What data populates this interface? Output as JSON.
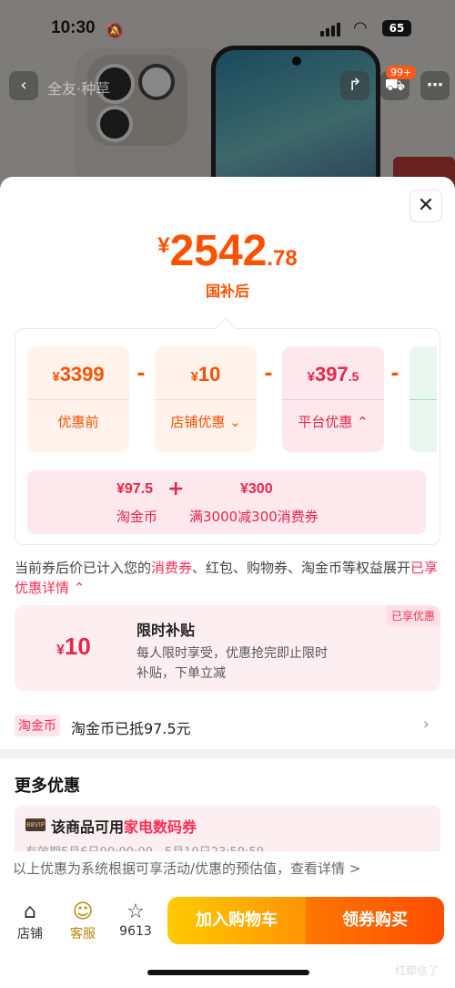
{
  "status_bar": {
    "time": "10:30",
    "battery": "65"
  },
  "nav": {
    "title": "全友·种草",
    "cart_badge": "99+"
  },
  "sheet": {
    "price": {
      "currency": "¥",
      "integer": "2542",
      "decimal": ".78",
      "label": "国补后"
    },
    "breakdown": [
      {
        "currency": "¥",
        "value": "3399",
        "decimal": "",
        "label": "优惠前"
      },
      {
        "currency": "¥",
        "value": "10",
        "decimal": "",
        "label": "店铺优惠",
        "chevron": "⌄"
      },
      {
        "currency": "¥",
        "value": "397",
        "decimal": ".5",
        "label": "平台优惠",
        "chevron": "⌃"
      }
    ],
    "operators": [
      "-",
      "-",
      "-"
    ],
    "platform_detail": {
      "coin_value": "¥97.5",
      "coin_label": "淘金币",
      "plus": "+",
      "coupon_value": "¥300",
      "coupon_label": "满3000减300消费券"
    },
    "notice": {
      "prefix": "当前券后价已计入您的",
      "highlight1": "消费券",
      "middle": "、红包、购物券、淘金币等权益展开",
      "link": "已享优惠详情",
      "link_chevron": "⌃"
    },
    "subsidy": {
      "currency": "¥",
      "amount": "10",
      "title": "限时补贴",
      "desc": "每人限时享受，优惠抢完即止限时补贴，下单立减",
      "tag": "已享优惠"
    },
    "coin_row": {
      "badge": "淘金币",
      "text": "淘金币已抵97.5元",
      "chevron": "›"
    },
    "more": {
      "title": "更多优惠",
      "coupon_prefix": "该商品可用",
      "coupon_highlight": "家电数码券",
      "vip": "88VIP",
      "validity": "有效期5月6日00:00:00 - 5月10日23:59:59"
    },
    "estimate": "以上优惠为系统根据可享活动/优惠的预估值，查看详情 >"
  },
  "bottom_bar": {
    "shop_label": "店铺",
    "service_label": "客服",
    "fav_count": "9613",
    "add_cart": "加入购物车",
    "buy": "领券购买",
    "watermark": "红都信了"
  },
  "colors": {
    "accent": "#ff5000",
    "platform": "#e8264a",
    "highlight": "#ff2d55"
  }
}
